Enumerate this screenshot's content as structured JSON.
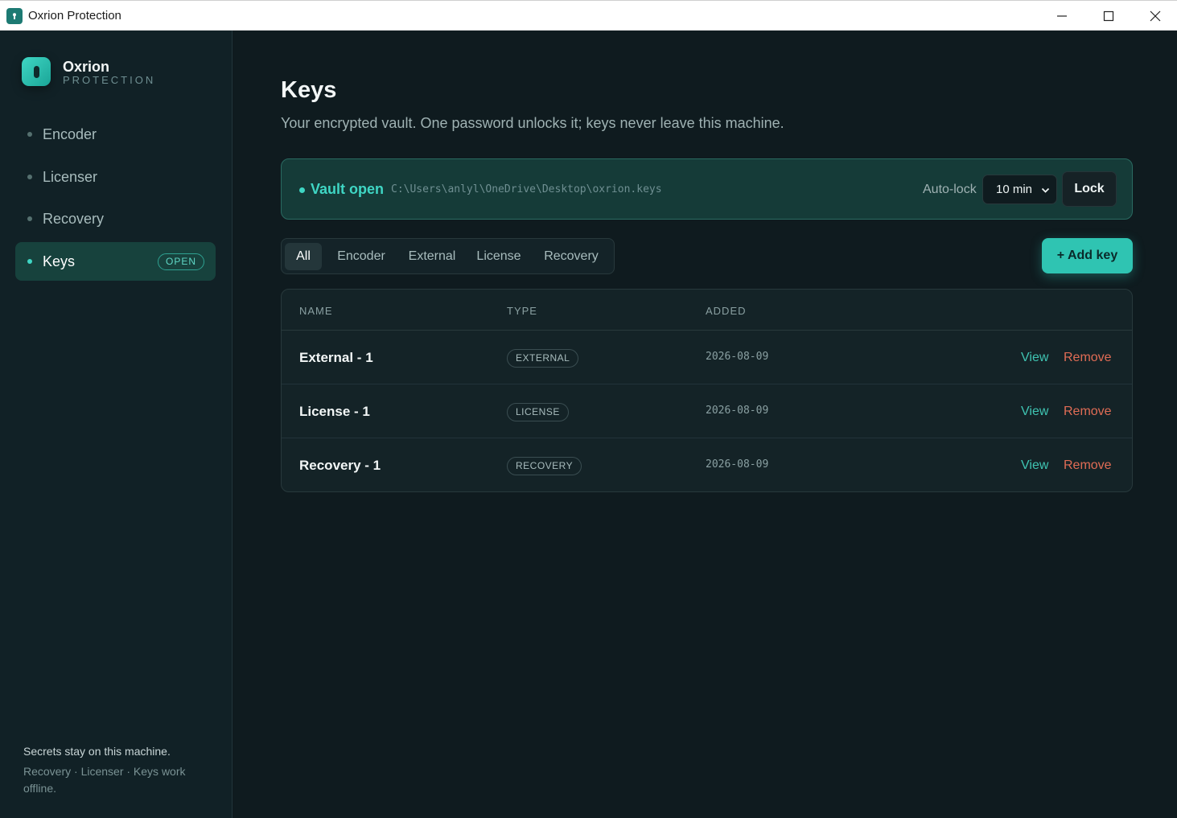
{
  "window": {
    "title": "Oxrion Protection",
    "app_icon": "keyhole-icon",
    "controls": [
      "minimize-icon",
      "maximize-icon",
      "close-icon"
    ]
  },
  "sidebar": {
    "brand": {
      "name": "Oxrion",
      "subtitle": "PROTECTION"
    },
    "items": [
      {
        "label": "Encoder",
        "active": false
      },
      {
        "label": "Licenser",
        "active": false
      },
      {
        "label": "Recovery",
        "active": false
      },
      {
        "label": "Keys",
        "active": true,
        "badge": "OPEN"
      }
    ],
    "footer": {
      "line1": "Secrets stay on this machine.",
      "line2": "Recovery · Licenser · Keys work offline."
    }
  },
  "main": {
    "title": "Keys",
    "subtitle": "Your encrypted vault. One password unlocks it; keys never leave this machine.",
    "vault": {
      "status": "Vault open",
      "path": "C:\\Users\\anlyl\\OneDrive\\Desktop\\oxrion.keys",
      "autolock_label": "Auto-lock",
      "autolock_value": "10 min",
      "lock_label": "Lock"
    },
    "tabs": [
      {
        "label": "All",
        "active": true
      },
      {
        "label": "Encoder",
        "active": false
      },
      {
        "label": "External",
        "active": false
      },
      {
        "label": "License",
        "active": false
      },
      {
        "label": "Recovery",
        "active": false
      }
    ],
    "add_button": "+ Add key",
    "table": {
      "columns": [
        "NAME",
        "TYPE",
        "ADDED"
      ],
      "rows": [
        {
          "name": "External - 1",
          "type": "EXTERNAL",
          "added": "2026-08-09",
          "view": "View",
          "remove": "Remove"
        },
        {
          "name": "License - 1",
          "type": "LICENSE",
          "added": "2026-08-09",
          "view": "View",
          "remove": "Remove"
        },
        {
          "name": "Recovery - 1",
          "type": "RECOVERY",
          "added": "2026-08-09",
          "view": "View",
          "remove": "Remove"
        }
      ]
    }
  },
  "colors": {
    "accent": "#3fd6c4",
    "button": "#2fc4b2",
    "danger": "#e06c55",
    "background": "#0f1b1f",
    "sidebar": "#112126"
  }
}
